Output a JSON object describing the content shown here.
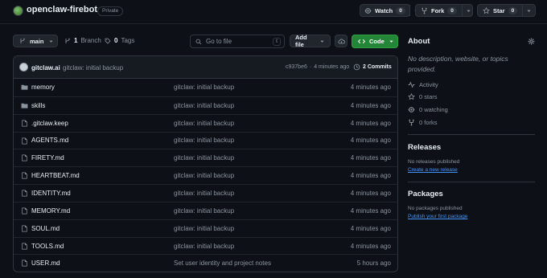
{
  "repo": {
    "name": "openclaw-firebot",
    "visibility": "Private"
  },
  "header_actions": {
    "watch_label": "Watch",
    "watch_count": "0",
    "fork_label": "Fork",
    "fork_count": "0",
    "star_label": "Star",
    "star_count": "0"
  },
  "toolbar": {
    "branch": "main",
    "branches_count": "1",
    "branches_label": "Branch",
    "tags_count": "0",
    "tags_label": "Tags",
    "goto_placeholder": "Go to file",
    "goto_shortcut": "t",
    "add_file_label": "Add file",
    "code_label": "Code"
  },
  "latest_commit": {
    "author": "gitclaw.ai",
    "message": "gitclaw: initial backup",
    "hash": "c937be6",
    "separator": "·",
    "time": "4 minutes ago",
    "commits_label": "2 Commits"
  },
  "files": [
    {
      "name": "memory",
      "type": "dir",
      "message": "gitclaw: initial backup",
      "time": "4 minutes ago"
    },
    {
      "name": "skills",
      "type": "dir",
      "message": "gitclaw: initial backup",
      "time": "4 minutes ago"
    },
    {
      "name": ".gitclaw.keep",
      "type": "file",
      "message": "gitclaw: initial backup",
      "time": "4 minutes ago"
    },
    {
      "name": "AGENTS.md",
      "type": "file",
      "message": "gitclaw: initial backup",
      "time": "4 minutes ago"
    },
    {
      "name": "FIRETY.md",
      "type": "file",
      "message": "gitclaw: initial backup",
      "time": "4 minutes ago"
    },
    {
      "name": "HEARTBEAT.md",
      "type": "file",
      "message": "gitclaw: initial backup",
      "time": "4 minutes ago"
    },
    {
      "name": "IDENTITY.md",
      "type": "file",
      "message": "gitclaw: initial backup",
      "time": "4 minutes ago"
    },
    {
      "name": "MEMORY.md",
      "type": "file",
      "message": "gitclaw: initial backup",
      "time": "4 minutes ago"
    },
    {
      "name": "SOUL.md",
      "type": "file",
      "message": "gitclaw: initial backup",
      "time": "4 minutes ago"
    },
    {
      "name": "TOOLS.md",
      "type": "file",
      "message": "gitclaw: initial backup",
      "time": "4 minutes ago"
    },
    {
      "name": "USER.md",
      "type": "file",
      "message": "Set user identity and project notes",
      "time": "5 hours ago"
    }
  ],
  "about": {
    "title": "About",
    "description": "No description, website, or topics provided.",
    "activity": "Activity",
    "stars": "0 stars",
    "watching": "0 watching",
    "forks": "0 forks"
  },
  "releases": {
    "title": "Releases",
    "empty": "No releases published",
    "link": "Create a new release"
  },
  "packages": {
    "title": "Packages",
    "empty": "No packages published",
    "link": "Publish your first package"
  },
  "colors": {
    "background": "#0d1117",
    "border": "#30363d",
    "code_button": "#238636",
    "link": "#4493f8",
    "muted": "#8b949e"
  }
}
